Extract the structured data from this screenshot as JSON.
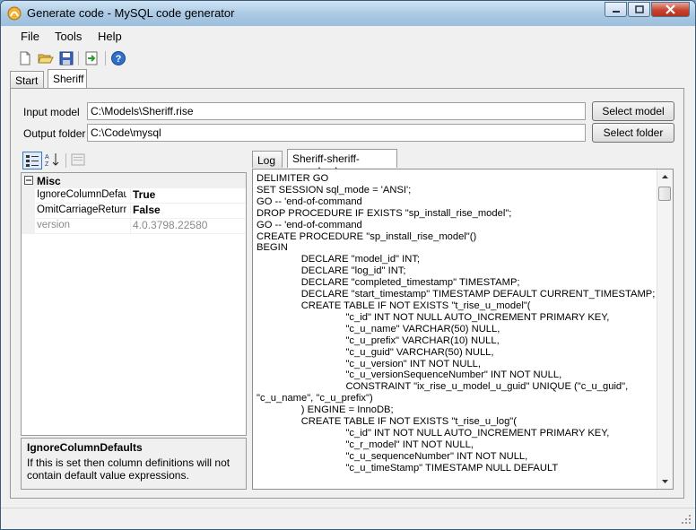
{
  "window": {
    "title": "Generate code - MySQL code generator"
  },
  "menu": {
    "file": "File",
    "tools": "Tools",
    "help": "Help"
  },
  "toolbar": {
    "buttons": [
      "new-icon",
      "open-icon",
      "save-icon",
      "export-icon",
      "help-icon"
    ]
  },
  "tabs": {
    "start": "Start",
    "sheriff": "Sheriff"
  },
  "form": {
    "input_model_label": "Input model",
    "input_model_value": "C:\\Models\\Sheriff.rise",
    "output_folder_label": "Output folder",
    "output_folder_value": "C:\\Code\\mysql",
    "select_model": "Select model",
    "select_folder": "Select folder"
  },
  "property_grid": {
    "category": "Misc",
    "rows": [
      {
        "name": "IgnoreColumnDefault",
        "value": "True"
      },
      {
        "name": "OmitCarriageReturn",
        "value": "False"
      },
      {
        "name": "version",
        "value": "4.0.3798.22580"
      }
    ],
    "help_title": "IgnoreColumnDefaults",
    "help_text": "If this is set then column definitions will not contain default value expressions."
  },
  "code_tabs": {
    "log": "Log",
    "file": "Sheriff-sheriff-mysql.sql"
  },
  "code_text": "DELIMITER GO\nSET SESSION sql_mode = 'ANSI';\nGO -- 'end-of-command\nDROP PROCEDURE IF EXISTS \"sp_install_rise_model\";\nGO -- 'end-of-command\nCREATE PROCEDURE \"sp_install_rise_model\"()\nBEGIN\n                DECLARE \"model_id\" INT;\n                DECLARE \"log_id\" INT;\n                DECLARE \"completed_timestamp\" TIMESTAMP;\n                DECLARE \"start_timestamp\" TIMESTAMP DEFAULT CURRENT_TIMESTAMP;\n                CREATE TABLE IF NOT EXISTS \"t_rise_u_model\"(\n                                \"c_id\" INT NOT NULL AUTO_INCREMENT PRIMARY KEY,\n                                \"c_u_name\" VARCHAR(50) NULL,\n                                \"c_u_prefix\" VARCHAR(10) NULL,\n                                \"c_u_guid\" VARCHAR(50) NULL,\n                                \"c_u_version\" INT NOT NULL,\n                                \"c_u_versionSequenceNumber\" INT NOT NULL,\n                                CONSTRAINT \"ix_rise_u_model_u_guid\" UNIQUE (\"c_u_guid\",\n\"c_u_name\", \"c_u_prefix\")\n                ) ENGINE = InnoDB;\n                CREATE TABLE IF NOT EXISTS \"t_rise_u_log\"(\n                                \"c_id\" INT NOT NULL AUTO_INCREMENT PRIMARY KEY,\n                                \"c_r_model\" INT NOT NULL,\n                                \"c_u_sequenceNumber\" INT NOT NULL,\n                                \"c_u_timeStamp\" TIMESTAMP NULL DEFAULT"
}
